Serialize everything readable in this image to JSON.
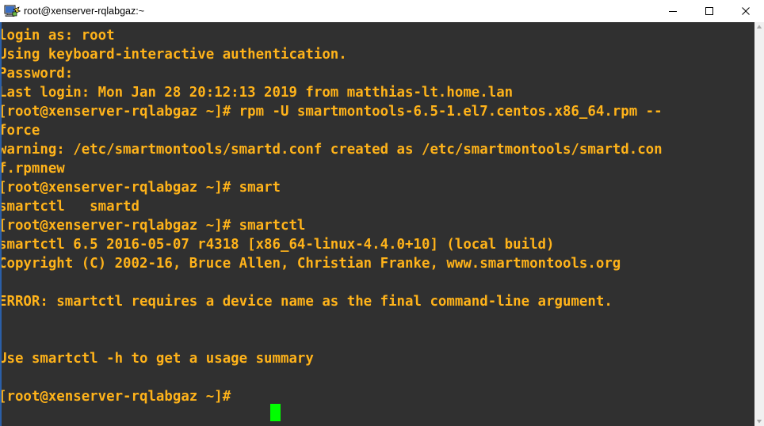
{
  "window": {
    "title": "root@xenserver-rqlabgaz:~",
    "icon": "putty-terminal-icon",
    "minimize_label": "—",
    "maximize_label": "□",
    "close_label": "✕"
  },
  "terminal": {
    "background_color": "#303030",
    "text_color": "#ffb31a",
    "cursor_color": "#00ff00",
    "prompt": "[root@xenserver-rqlabgaz ~]#",
    "lines": [
      "login as: root",
      "Using keyboard-interactive authentication.",
      "Password:",
      "Last login: Mon Jan 28 20:12:13 2019 from matthias-lt.home.lan",
      "[root@xenserver-rqlabgaz ~]# rpm -U smartmontools-6.5-1.el7.centos.x86_64.rpm --",
      "force",
      "warning: /etc/smartmontools/smartd.conf created as /etc/smartmontools/smartd.con",
      "f.rpmnew",
      "[root@xenserver-rqlabgaz ~]# smart",
      "smartctl   smartd",
      "[root@xenserver-rqlabgaz ~]# smartctl",
      "smartctl 6.5 2016-05-07 r4318 [x86_64-linux-4.4.0+10] (local build)",
      "Copyright (C) 2002-16, Bruce Allen, Christian Franke, www.smartmontools.org",
      "",
      "ERROR: smartctl requires a device name as the final command-line argument.",
      "",
      "",
      "Use smartctl -h to get a usage summary",
      "",
      "[root@xenserver-rqlabgaz ~]# "
    ]
  },
  "scrollbar": {
    "up_arrow": "scroll-up-arrow",
    "down_arrow": "scroll-down-arrow"
  }
}
